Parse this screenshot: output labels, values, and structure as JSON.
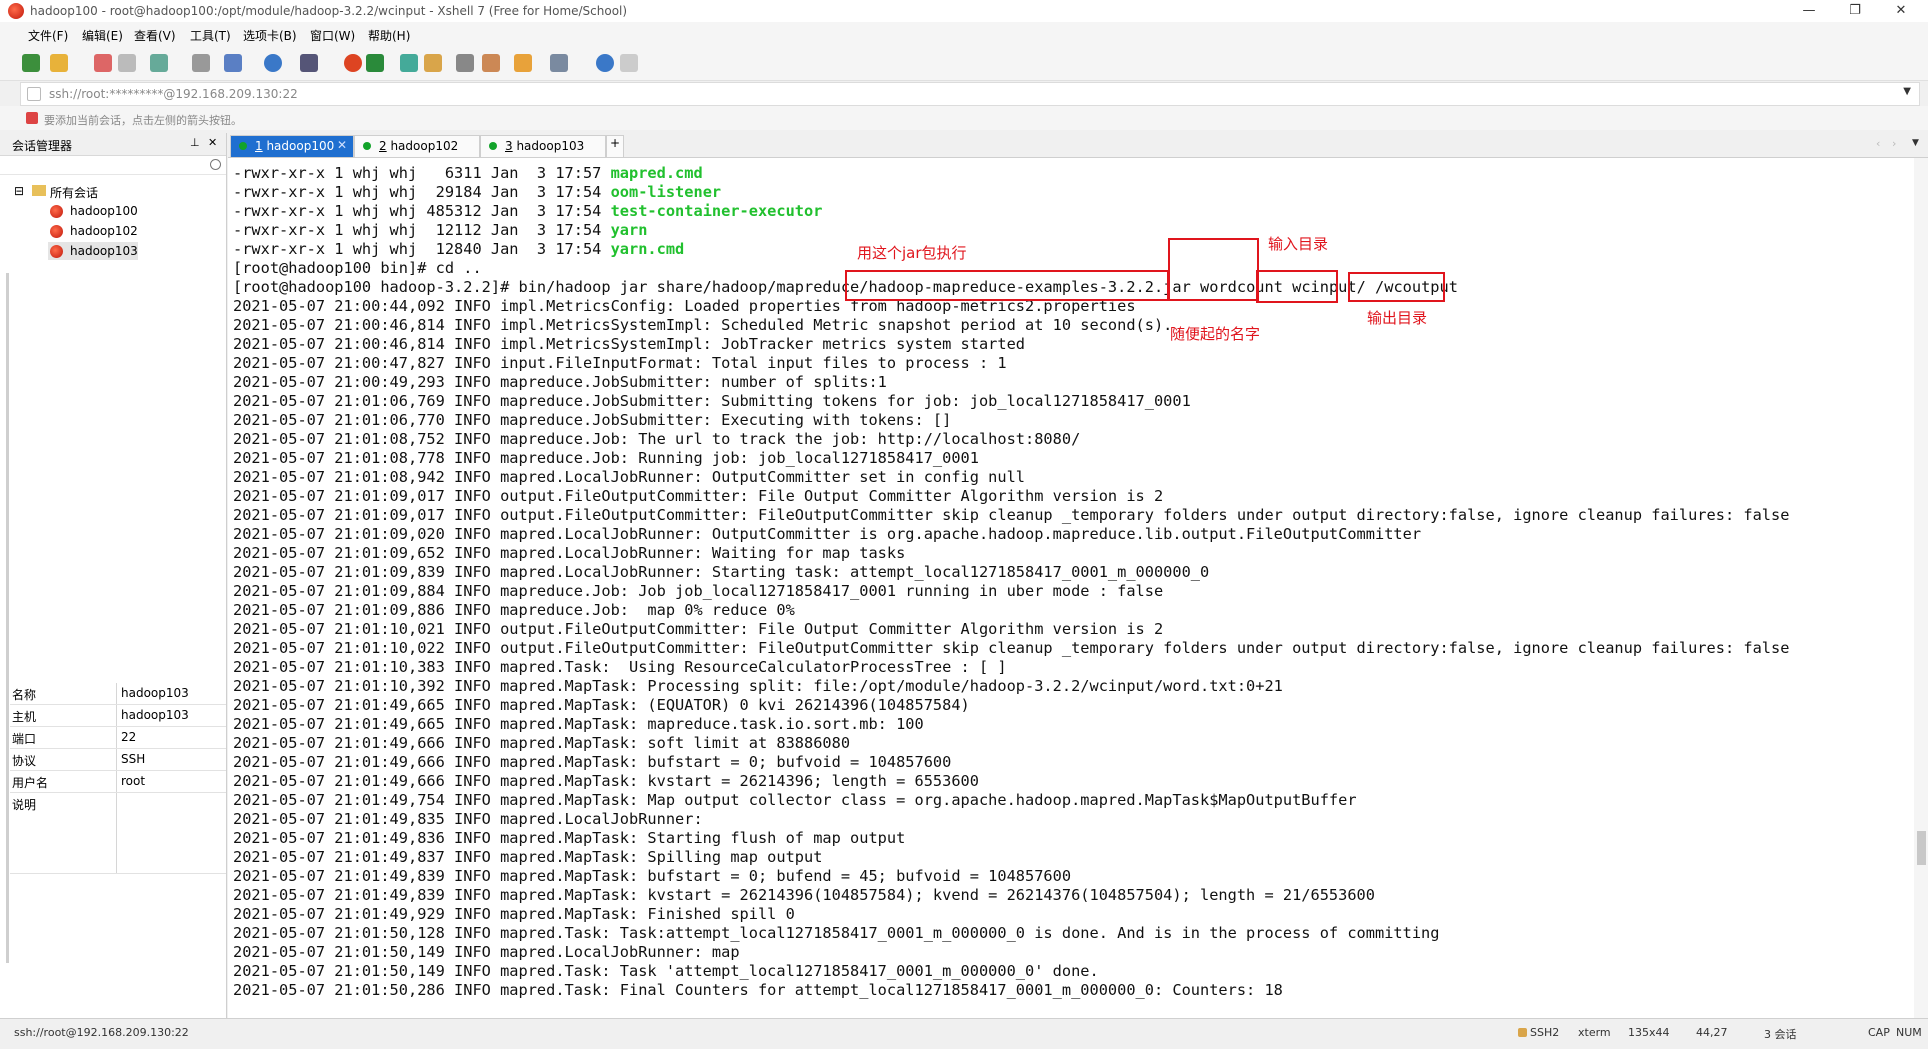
{
  "window": {
    "title": "hadoop100 - root@hadoop100:/opt/module/hadoop-3.2.2/wcinput - Xshell 7 (Free for Home/School)",
    "controls": [
      "—",
      "❐",
      "✕"
    ]
  },
  "menu": [
    "文件(F)",
    "编辑(E)",
    "查看(V)",
    "工具(T)",
    "选项卡(B)",
    "窗口(W)",
    "帮助(H)"
  ],
  "address": "ssh://root:*********@192.168.209.130:22",
  "hint": "要添加当前会话，点击左侧的箭头按钮。",
  "session_panel": {
    "title": "会话管理器",
    "pin": "⊥",
    "close": "✕",
    "search_icon": "search-icon",
    "root": "所有会话",
    "sessions": [
      "hadoop100",
      "hadoop102",
      "hadoop103"
    ],
    "properties": [
      {
        "key": "名称",
        "value": "hadoop103"
      },
      {
        "key": "主机",
        "value": "hadoop103"
      },
      {
        "key": "端口",
        "value": "22"
      },
      {
        "key": "协议",
        "value": "SSH"
      },
      {
        "key": "用户名",
        "value": "root"
      },
      {
        "key": "说明",
        "value": ""
      }
    ]
  },
  "tabs": [
    {
      "num": "1",
      "label": " hadoop100"
    },
    {
      "num": "2",
      "label": " hadoop102"
    },
    {
      "num": "3",
      "label": " hadoop103"
    }
  ],
  "tab_add": "+",
  "terminal": {
    "files": [
      {
        "prefix": "-rwxr-xr-x 1 whj whj   6311 Jan  3 17:57 ",
        "name": "mapred.cmd"
      },
      {
        "prefix": "-rwxr-xr-x 1 whj whj  29184 Jan  3 17:54 ",
        "name": "oom-listener"
      },
      {
        "prefix": "-rwxr-xr-x 1 whj whj 485312 Jan  3 17:54 ",
        "name": "test-container-executor"
      },
      {
        "prefix": "-rwxr-xr-x 1 whj whj  12112 Jan  3 17:54 ",
        "name": "yarn"
      },
      {
        "prefix": "-rwxr-xr-x 1 whj whj  12840 Jan  3 17:54 ",
        "name": "yarn.cmd"
      }
    ],
    "cd_line": "[root@hadoop100 bin]# cd ..",
    "cmd": {
      "prompt": "[root@hadoop100 hadoop-3.2.2]# bin/hadoop jar share/hadoop/mapreduce",
      "jar": "/hadoop-mapreduce-examples-3.2.2.jar",
      "program": "wordcount",
      "input": "wcinput/",
      "output": "/wcoutput"
    },
    "log": [
      "2021-05-07 21:00:44,092 INFO impl.MetricsConfig: Loaded properties from hadoop-metrics2.properties",
      "2021-05-07 21:00:46,814 INFO impl.MetricsSystemImpl: Scheduled Metric snapshot period at 10 second(s).",
      "2021-05-07 21:00:46,814 INFO impl.MetricsSystemImpl: JobTracker metrics system started",
      "2021-05-07 21:00:47,827 INFO input.FileInputFormat: Total input files to process : 1",
      "2021-05-07 21:00:49,293 INFO mapreduce.JobSubmitter: number of splits:1",
      "2021-05-07 21:01:06,769 INFO mapreduce.JobSubmitter: Submitting tokens for job: job_local1271858417_0001",
      "2021-05-07 21:01:06,770 INFO mapreduce.JobSubmitter: Executing with tokens: []",
      "2021-05-07 21:01:08,752 INFO mapreduce.Job: The url to track the job: http://localhost:8080/",
      "2021-05-07 21:01:08,778 INFO mapreduce.Job: Running job: job_local1271858417_0001",
      "2021-05-07 21:01:08,942 INFO mapred.LocalJobRunner: OutputCommitter set in config null",
      "2021-05-07 21:01:09,017 INFO output.FileOutputCommitter: File Output Committer Algorithm version is 2",
      "2021-05-07 21:01:09,017 INFO output.FileOutputCommitter: FileOutputCommitter skip cleanup _temporary folders under output directory:false, ignore cleanup failures: false",
      "2021-05-07 21:01:09,020 INFO mapred.LocalJobRunner: OutputCommitter is org.apache.hadoop.mapreduce.lib.output.FileOutputCommitter",
      "2021-05-07 21:01:09,652 INFO mapred.LocalJobRunner: Waiting for map tasks",
      "2021-05-07 21:01:09,839 INFO mapred.LocalJobRunner: Starting task: attempt_local1271858417_0001_m_000000_0",
      "2021-05-07 21:01:09,884 INFO mapreduce.Job: Job job_local1271858417_0001 running in uber mode : false",
      "2021-05-07 21:01:09,886 INFO mapreduce.Job:  map 0% reduce 0%",
      "2021-05-07 21:01:10,021 INFO output.FileOutputCommitter: File Output Committer Algorithm version is 2",
      "2021-05-07 21:01:10,022 INFO output.FileOutputCommitter: FileOutputCommitter skip cleanup _temporary folders under output directory:false, ignore cleanup failures: false",
      "2021-05-07 21:01:10,383 INFO mapred.Task:  Using ResourceCalculatorProcessTree : [ ]",
      "2021-05-07 21:01:10,392 INFO mapred.MapTask: Processing split: file:/opt/module/hadoop-3.2.2/wcinput/word.txt:0+21",
      "2021-05-07 21:01:49,665 INFO mapred.MapTask: (EQUATOR) 0 kvi 26214396(104857584)",
      "2021-05-07 21:01:49,665 INFO mapred.MapTask: mapreduce.task.io.sort.mb: 100",
      "2021-05-07 21:01:49,666 INFO mapred.MapTask: soft limit at 83886080",
      "2021-05-07 21:01:49,666 INFO mapred.MapTask: bufstart = 0; bufvoid = 104857600",
      "2021-05-07 21:01:49,666 INFO mapred.MapTask: kvstart = 26214396; length = 6553600",
      "2021-05-07 21:01:49,754 INFO mapred.MapTask: Map output collector class = org.apache.hadoop.mapred.MapTask$MapOutputBuffer",
      "2021-05-07 21:01:49,835 INFO mapred.LocalJobRunner:",
      "2021-05-07 21:01:49,836 INFO mapred.MapTask: Starting flush of map output",
      "2021-05-07 21:01:49,837 INFO mapred.MapTask: Spilling map output",
      "2021-05-07 21:01:49,839 INFO mapred.MapTask: bufstart = 0; bufend = 45; bufvoid = 104857600",
      "2021-05-07 21:01:49,839 INFO mapred.MapTask: kvstart = 26214396(104857584); kvend = 26214376(104857504); length = 21/6553600",
      "2021-05-07 21:01:49,929 INFO mapred.MapTask: Finished spill 0",
      "2021-05-07 21:01:50,128 INFO mapred.Task: Task:attempt_local1271858417_0001_m_000000_0 is done. And is in the process of committing",
      "2021-05-07 21:01:50,149 INFO mapred.LocalJobRunner: map",
      "2021-05-07 21:01:50,149 INFO mapred.Task: Task 'attempt_local1271858417_0001_m_000000_0' done.",
      "2021-05-07 21:01:50,286 INFO mapred.Task: Final Counters for attempt_local1271858417_0001_m_000000_0: Counters: 18"
    ]
  },
  "annotations": {
    "jar": "用这个jar包执行",
    "input": "输入目录",
    "name": "随便起的名字",
    "output": "输出目录"
  },
  "status": {
    "left": "ssh://root@192.168.209.130:22",
    "protocol": "SSH2",
    "term": "xterm",
    "size": "135x44",
    "pos": "44,27",
    "sessions": "3 会话",
    "cap": "CAP",
    "num": "NUM"
  }
}
